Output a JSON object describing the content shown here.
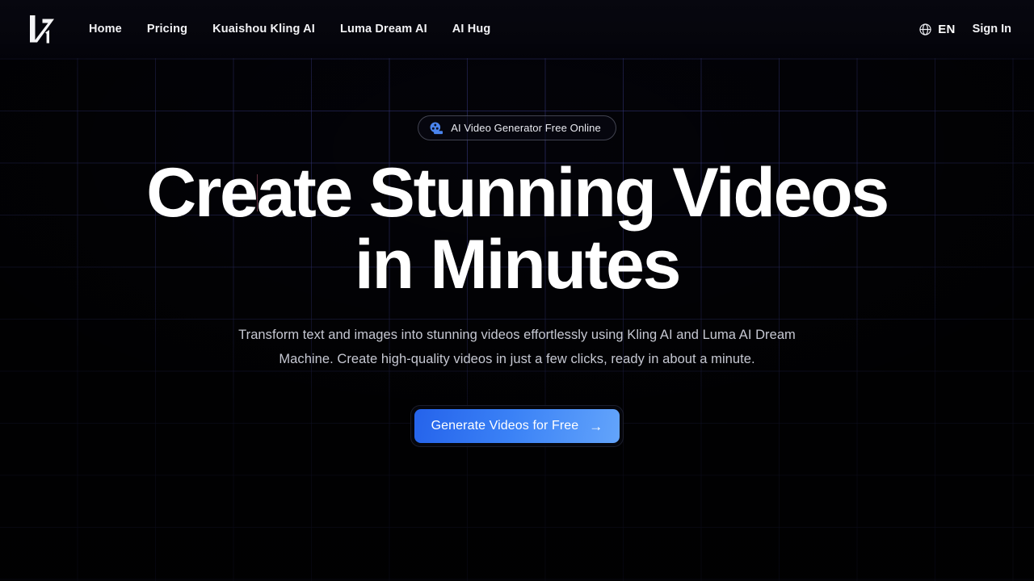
{
  "header": {
    "logo": {
      "name": "v1-logo",
      "alt": "V1"
    },
    "nav": [
      {
        "label": "Home",
        "name": "nav-link-home"
      },
      {
        "label": "Pricing",
        "name": "nav-link-pricing"
      },
      {
        "label": "Kuaishou Kling AI",
        "name": "nav-link-kuaishou-kling-ai"
      },
      {
        "label": "Luma Dream AI",
        "name": "nav-link-luma-dream-ai"
      },
      {
        "label": "AI Hug",
        "name": "nav-link-ai-hug"
      }
    ],
    "language": {
      "icon": "globe-icon",
      "code": "EN"
    },
    "sign_in_label": "Sign In"
  },
  "hero": {
    "badge": {
      "icon": "film-reel-icon",
      "label": "AI Video Generator Free Online"
    },
    "title": "Create Stunning Videos in Minutes",
    "subtitle": "Transform text and images into stunning videos effortlessly using Kling AI and Luma AI Dream Machine. Create high-quality videos in just a few clicks, ready in about a minute.",
    "cta": {
      "label": "Generate Videos for Free",
      "arrow": "→"
    }
  },
  "colors": {
    "page_background": "#000000",
    "grid_line": "#3c3e8c",
    "accent_blue": "#3b82f6",
    "cta_gradient_start": "#2563eb",
    "cta_gradient_end": "#63a4fb",
    "badge_icon_blue": "#4a84ee",
    "title_text": "#ffffff",
    "subtitle_text": "#c6c8d2"
  }
}
